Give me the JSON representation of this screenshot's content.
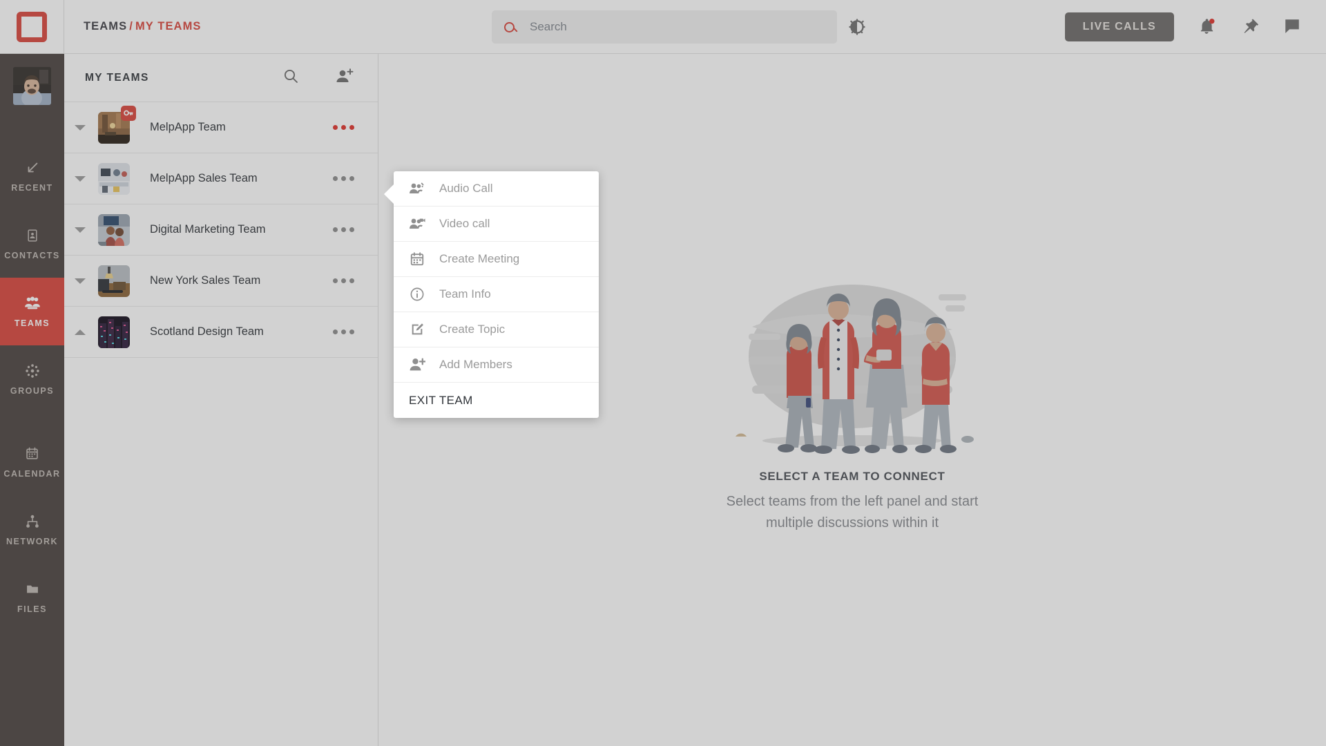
{
  "header": {
    "logo_icon": "app-logo-square",
    "breadcrumb": {
      "parent": "TEAMS",
      "separator": "/",
      "current": "MY TEAMS"
    },
    "search": {
      "placeholder": "Search",
      "value": "",
      "icon": "search-icon"
    },
    "power_icon": "power-toggle-icon",
    "live_calls_label": "LIVE CALLS",
    "icons": {
      "notifications": "bell-icon",
      "notification_badge_color": "#e0332c",
      "pin": "pin-icon",
      "messages": "chat-bubble-icon"
    }
  },
  "rail": {
    "avatar_icon": "user-avatar",
    "items": [
      {
        "label": "RECENT",
        "icon": "arrow-down-left-icon",
        "active": false
      },
      {
        "label": "CONTACTS",
        "icon": "contact-card-icon",
        "active": false
      },
      {
        "label": "TEAMS",
        "icon": "teams-icon",
        "active": true
      },
      {
        "label": "GROUPS",
        "icon": "groups-icon",
        "active": false
      },
      {
        "label": "CALENDAR",
        "icon": "calendar-icon",
        "active": false
      },
      {
        "label": "NETWORK",
        "icon": "network-icon",
        "active": false
      },
      {
        "label": "FILES",
        "icon": "folder-icon",
        "active": false
      }
    ],
    "active_color": "#d9453c",
    "background_color": "#4b4340"
  },
  "panel": {
    "title": "MY TEAMS",
    "search_icon": "search-icon",
    "add_members_icon": "add-members-icon",
    "teams": [
      {
        "name": "MelpApp Team",
        "expanded": false,
        "locked": true,
        "menu_active": true,
        "thumb": "office-interior"
      },
      {
        "name": "MelpApp Sales Team",
        "expanded": false,
        "locked": false,
        "menu_active": false,
        "thumb": "meeting-room"
      },
      {
        "name": "Digital Marketing Team",
        "expanded": false,
        "locked": false,
        "menu_active": false,
        "thumb": "two-women-desk"
      },
      {
        "name": "New York Sales Team",
        "expanded": false,
        "locked": false,
        "menu_active": false,
        "thumb": "desk-lamp"
      },
      {
        "name": "Scotland Design Team",
        "expanded": true,
        "locked": false,
        "menu_active": false,
        "thumb": "city-night"
      }
    ]
  },
  "context_menu": {
    "items": [
      {
        "label": "Audio Call",
        "icon": "audio-call-icon"
      },
      {
        "label": "Video call",
        "icon": "video-call-icon"
      },
      {
        "label": "Create Meeting",
        "icon": "calendar-icon"
      },
      {
        "label": "Team Info",
        "icon": "info-icon"
      },
      {
        "label": "Create Topic",
        "icon": "edit-square-icon"
      },
      {
        "label": "Add Members",
        "icon": "add-person-icon"
      }
    ],
    "exit_label": "EXIT TEAM"
  },
  "empty_state": {
    "illustration": "four-people-standing-illustration",
    "title": "SELECT A TEAM TO CONNECT",
    "subtitle": "Select teams from the left panel and start multiple discussions within it"
  }
}
